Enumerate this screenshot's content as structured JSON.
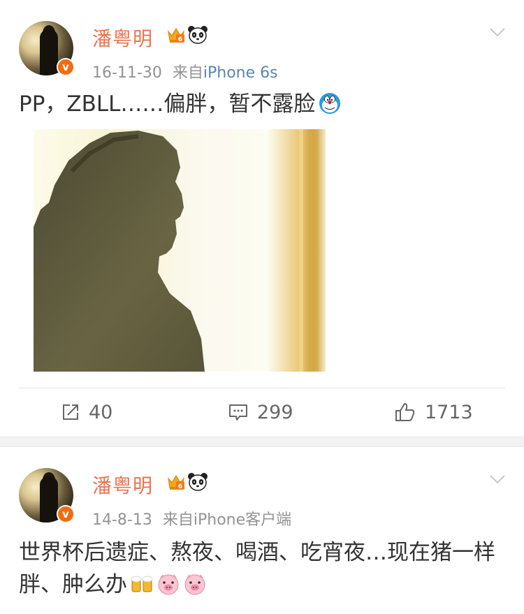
{
  "posts": [
    {
      "author": "潘粤明",
      "timestamp": "16-11-30",
      "source_prefix": "来自",
      "source": "iPhone 6s",
      "text": "PP，ZBLL……偏胖，暂不露脸",
      "actions": {
        "repost": "40",
        "comment": "299",
        "like": "1713"
      }
    },
    {
      "author": "潘粤明",
      "timestamp": "14-8-13",
      "source_prefix": "来自",
      "source": "iPhone客户端",
      "text": "世界杯后遗症、熬夜、喝酒、吃宵夜…现在猪一样胖、肿么办"
    }
  ],
  "verified_badge": "v",
  "icons": {
    "crown": "crown-member-icon",
    "panda": "panda-icon",
    "chevron": "chevron-down-icon",
    "doraemon": "doraemon-emoji",
    "beer": "beer-emoji",
    "pig": "pig-emoji",
    "repost": "repost-icon",
    "comment": "comment-icon",
    "like": "like-icon"
  },
  "colors": {
    "author_name": "#eb7350",
    "source_link": "#5b85b5",
    "meta_text": "#939393",
    "verified_badge": "#f26b10"
  }
}
